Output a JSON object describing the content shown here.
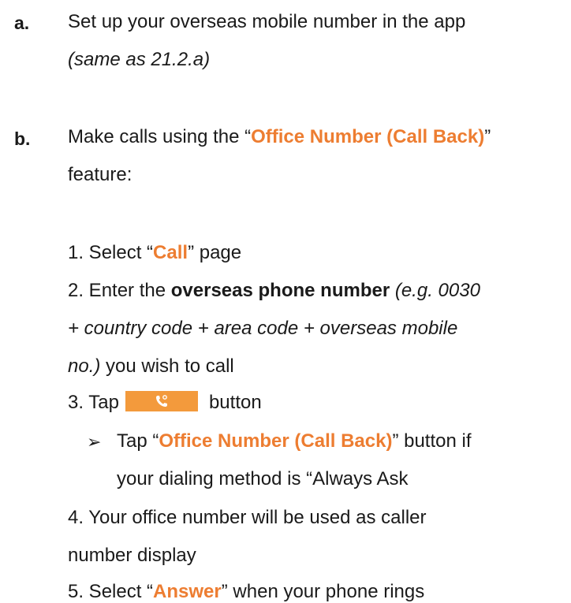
{
  "items": {
    "a": {
      "label": "a.",
      "line1": "Set up your overseas mobile number in the app",
      "line2": "(same as 21.2.a)"
    },
    "b": {
      "label": "b.",
      "line1_pre": "Make calls using the “",
      "line1_highlight": "Office Number (Call Back)",
      "line1_post": "”",
      "line2": "feature:"
    }
  },
  "steps": {
    "s1_pre": "1. Select “",
    "s1_highlight": "Call",
    "s1_post": "” page",
    "s2_pre": "2. Enter the ",
    "s2_bold": "overseas phone number",
    "s2_italic1": "(e.g. 0030",
    "s2_italic2": "+ country code + area code + overseas mobile",
    "s2_italic3": "no.)",
    "s2_post": " you wish to call",
    "s3_pre": "3. Tap",
    "s3_post": "button",
    "sub_arrow": "➢",
    "sub_pre": "Tap “",
    "sub_highlight": "Office Number (Call Back)",
    "sub_post": "” button if",
    "sub_line2": "your dialing method is “Always Ask",
    "s4_line1": "4. Your office number will be used as caller",
    "s4_line2": "number display",
    "s5_pre": "5. Select “",
    "s5_highlight": "Answer",
    "s5_post": "” when your phone rings"
  },
  "icons": {
    "call_button_icon": "phone-callback-icon"
  },
  "colors": {
    "accent": "#ed7d31",
    "button": "#f39a3c"
  }
}
